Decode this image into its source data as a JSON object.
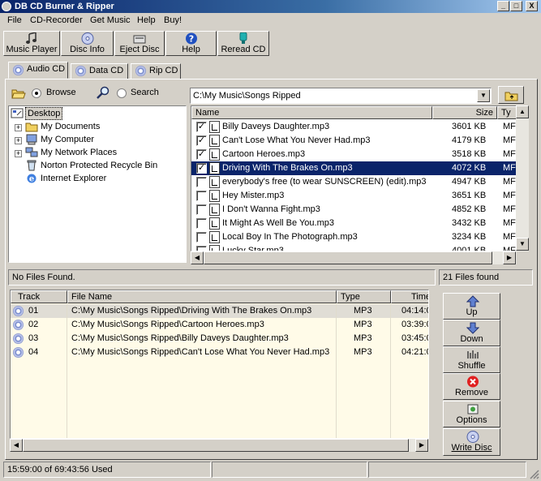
{
  "window": {
    "title": "DB CD Burner & Ripper"
  },
  "window_controls": {
    "minimize": "_",
    "maximize": "□",
    "close": "X"
  },
  "menu": [
    "File",
    "CD-Recorder",
    "Get Music",
    "Help",
    "Buy!"
  ],
  "toolbar": [
    "Music Player",
    "Disc Info",
    "Eject Disc",
    "Help",
    "Reread CD"
  ],
  "tabs": [
    "Audio CD",
    "Data CD",
    "Rip CD"
  ],
  "browse": {
    "browse_label": "Browse",
    "search_label": "Search",
    "path": "C:\\My Music\\Songs Ripped"
  },
  "tree": [
    "Desktop",
    "My Documents",
    "My Computer",
    "My Network Places",
    "Norton Protected Recycle Bin",
    "Internet Explorer"
  ],
  "files": {
    "columns": [
      "Name",
      "Size",
      "Ty"
    ],
    "rows": [
      {
        "checked": true,
        "name": "Billy Daveys Daughter.mp3",
        "size": "3601 KB",
        "type": "MF"
      },
      {
        "checked": true,
        "name": "Can't Lose What You Never Had.mp3",
        "size": "4179 KB",
        "type": "MF"
      },
      {
        "checked": true,
        "name": "Cartoon Heroes.mp3",
        "size": "3518 KB",
        "type": "MF"
      },
      {
        "checked": true,
        "name": "Driving With The Brakes On.mp3",
        "size": "4072 KB",
        "type": "MF",
        "selected": true
      },
      {
        "checked": false,
        "name": "everybody's free (to wear SUNSCREEN) (edit).mp3",
        "size": "4947 KB",
        "type": "MF"
      },
      {
        "checked": false,
        "name": "Hey Mister.mp3",
        "size": "3651 KB",
        "type": "MF"
      },
      {
        "checked": false,
        "name": "I Don't Wanna Fight.mp3",
        "size": "4852 KB",
        "type": "MF"
      },
      {
        "checked": false,
        "name": "It Might As Well Be You.mp3",
        "size": "3432 KB",
        "type": "MF"
      },
      {
        "checked": false,
        "name": "Local Boy In The Photograph.mp3",
        "size": "3234 KB",
        "type": "MF"
      },
      {
        "checked": false,
        "name": "Lucky Star.mp3",
        "size": "4001 KB",
        "type": "MF"
      }
    ]
  },
  "status_left": "No Files Found.",
  "status_right": "21 Files found",
  "tracks": {
    "columns": [
      "Track",
      "File Name",
      "Type",
      "Time"
    ],
    "rows": [
      {
        "track": "01",
        "file": "C:\\My Music\\Songs Ripped\\Driving With The Brakes On.mp3",
        "type": "MP3",
        "time": "04:14:0",
        "selected": true
      },
      {
        "track": "02",
        "file": "C:\\My Music\\Songs Ripped\\Cartoon Heroes.mp3",
        "type": "MP3",
        "time": "03:39:0"
      },
      {
        "track": "03",
        "file": "C:\\My Music\\Songs Ripped\\Billy Daveys Daughter.mp3",
        "type": "MP3",
        "time": "03:45:0"
      },
      {
        "track": "04",
        "file": "C:\\My Music\\Songs Ripped\\Can't Lose What You Never Had.mp3",
        "type": "MP3",
        "time": "04:21:0"
      }
    ]
  },
  "side_buttons": [
    "Up",
    "Down",
    "Shuffle",
    "Remove",
    "Options",
    "Write Disc"
  ],
  "statusbar": {
    "used": "15:59:00 of 69:43:56 Used"
  },
  "colors": {
    "title_start": "#0a246a",
    "title_end": "#a6caf0",
    "selection": "#0a246a",
    "track_bg": "#fffbe8",
    "remove": "#e02020"
  }
}
